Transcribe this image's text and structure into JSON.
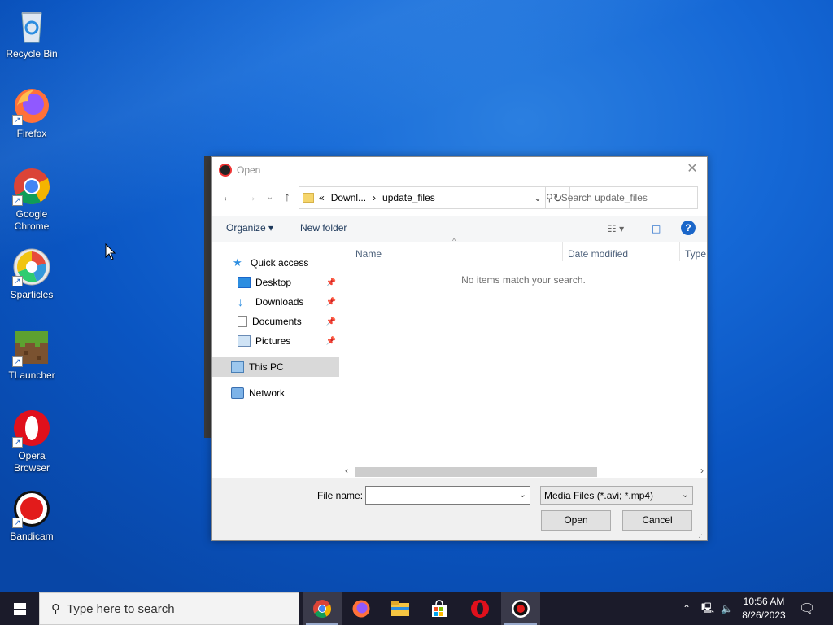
{
  "desktop": {
    "icons": [
      {
        "label": "Recycle Bin",
        "icon": "recycle-bin-icon"
      },
      {
        "label": "Firefox",
        "icon": "firefox-icon"
      },
      {
        "label": "Google Chrome",
        "icon": "chrome-icon"
      },
      {
        "label": "Sparticles",
        "icon": "sparticles-icon"
      },
      {
        "label": "TLauncher",
        "icon": "tlauncher-icon"
      },
      {
        "label": "Opera Browser",
        "icon": "opera-icon"
      },
      {
        "label": "Bandicam",
        "icon": "bandicam-icon"
      }
    ]
  },
  "dialog": {
    "title": "Open",
    "address": {
      "chevrons": "«",
      "segment1": "Downl...",
      "separator": "›",
      "segment2": "update_files"
    },
    "search_placeholder": "Search update_files",
    "toolbar": {
      "organize": "Organize ▾",
      "new_folder": "New folder",
      "help": "?"
    },
    "nav": {
      "quick_access": "Quick access",
      "desktop": "Desktop",
      "downloads": "Downloads",
      "documents": "Documents",
      "pictures": "Pictures",
      "this_pc": "This PC",
      "network": "Network"
    },
    "columns": {
      "name": "Name",
      "date_modified": "Date modified",
      "type": "Type"
    },
    "empty_message": "No items match your search.",
    "file_name_label": "File name:",
    "file_name_value": "",
    "filter": "Media Files (*.avi; *.mp4)",
    "open_button": "Open",
    "cancel_button": "Cancel"
  },
  "taskbar": {
    "search_placeholder": "Type here to search",
    "apps": [
      "chrome-icon",
      "firefox-icon",
      "file-explorer-icon",
      "store-icon",
      "opera-icon",
      "bandicam-icon"
    ],
    "time": "10:56 AM",
    "date": "8/26/2023"
  }
}
